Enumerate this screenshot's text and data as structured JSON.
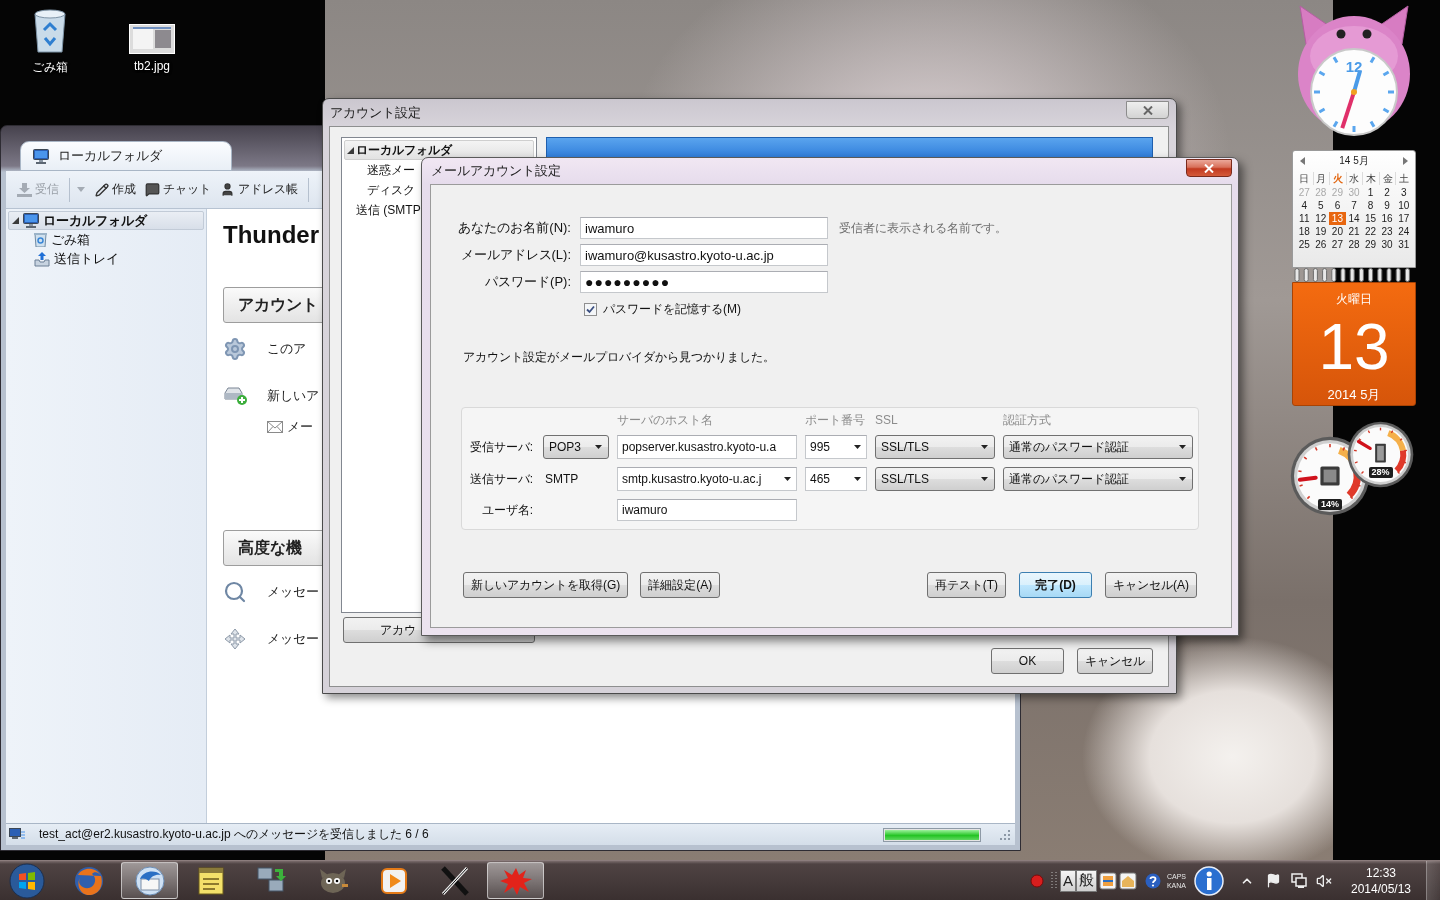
{
  "desktop_icons": [
    {
      "kind": "trash",
      "label": "ごみ箱"
    },
    {
      "kind": "image",
      "label": "tb2.jpg"
    }
  ],
  "mail_window": {
    "tab": {
      "label": "ローカルフォルダ",
      "selected": true
    },
    "toolbar": [
      {
        "kind": "get",
        "label": "受信",
        "disabled": true
      },
      {
        "kind": "write",
        "label": "作成",
        "disabled": false
      },
      {
        "kind": "chat",
        "label": "チャット",
        "disabled": false
      },
      {
        "kind": "address",
        "label": "アドレス帳",
        "disabled": false
      }
    ],
    "folders": [
      {
        "kind": "account",
        "label": "ローカルフォルダ",
        "selected": true,
        "expanded": true,
        "children": [
          {
            "kind": "trash",
            "label": "ごみ箱",
            "selected": false
          },
          {
            "kind": "outbox",
            "label": "送信トレイ",
            "selected": false
          }
        ]
      }
    ],
    "heading": "Thunder",
    "sections": [
      {
        "title": "アカウント",
        "items": [
          {
            "kind": "settings",
            "label": "このア"
          },
          {
            "kind": "new-account",
            "label": "新しいア"
          },
          {
            "kind": "mail",
            "label": "メー"
          }
        ]
      },
      {
        "title": "高度な機",
        "items": [
          {
            "kind": "search",
            "label": "メッセー"
          },
          {
            "kind": "filter",
            "label": "メッセー"
          }
        ]
      }
    ],
    "status_bar": {
      "text": "test_act@er2.kusastro.kyoto-u.ac.jp へのメッセージを受信しました 6 / 6",
      "level": 1
    }
  },
  "account_settings": {
    "title": "アカウント設定",
    "tree": [
      {
        "label": "ローカルフォルダ",
        "selected": true,
        "expanded": true,
        "children": [
          {
            "label": "迷惑メー",
            "selected": false
          },
          {
            "label": "ディスク",
            "selected": false
          }
        ]
      },
      {
        "label": "送信 (SMTP",
        "selected": false
      }
    ],
    "action_button": "アカウ",
    "buttons": [
      "OK",
      "キャンセル"
    ]
  },
  "mail_setup": {
    "title": "メールアカウント設定",
    "fields": [
      {
        "kind": "text",
        "label": "あなたのお名前(N):",
        "value": "iwamuro",
        "hint": "受信者に表示される名前です。"
      },
      {
        "kind": "text",
        "label": "メールアドレス(L):",
        "value": "iwamuro@kusastro.kyoto-u.ac.jp"
      },
      {
        "kind": "password",
        "label": "パスワード(P):",
        "value": "●●●●●●●●●"
      }
    ],
    "remember_password": {
      "label": "パスワードを記憶する(M)",
      "checked": true
    },
    "message": "アカウント設定がメールプロバイダから見つかりました。",
    "server_columns": [
      "サーバのホスト名",
      "ポート番号",
      "SSL",
      "認証方式"
    ],
    "servers": [
      {
        "kind": "incoming",
        "label": "受信サーバ:",
        "protocol": "POP3",
        "host": "popserver.kusastro.kyoto-u.a",
        "port": "995",
        "ssl": "SSL/TLS",
        "auth": "通常のパスワード認証"
      },
      {
        "kind": "outgoing",
        "label": "送信サーバ:",
        "protocol": "SMTP",
        "host": "smtp.kusastro.kyoto-u.ac.j",
        "port": "465",
        "ssl": "SSL/TLS",
        "auth": "通常のパスワード認証"
      }
    ],
    "username": {
      "label": "ユーザ名:",
      "value": "iwamuro"
    },
    "left_buttons": [
      {
        "label": "新しいアカウントを取得(G)",
        "default": false
      },
      {
        "label": "詳細設定(A)",
        "default": false
      }
    ],
    "right_buttons": [
      {
        "label": "再テスト(T)",
        "default": false
      },
      {
        "label": "完了(D)",
        "default": true
      },
      {
        "label": "キャンセル(A)",
        "default": false
      }
    ]
  },
  "clock_gadget": {
    "numeral": "12"
  },
  "calendar_gadget": {
    "header": "14 5月",
    "weekdays": [
      {
        "label": "日",
        "highlighted": false
      },
      {
        "label": "月",
        "highlighted": false
      },
      {
        "label": "火",
        "highlighted": true
      },
      {
        "label": "水",
        "highlighted": false
      },
      {
        "label": "木",
        "highlighted": false
      },
      {
        "label": "金",
        "highlighted": false
      },
      {
        "label": "土",
        "highlighted": false
      }
    ],
    "days": [
      {
        "label": "27",
        "outside": true,
        "selected": false
      },
      {
        "label": "28",
        "outside": true,
        "selected": false
      },
      {
        "label": "29",
        "outside": true,
        "selected": false
      },
      {
        "label": "30",
        "outside": true,
        "selected": false
      },
      {
        "label": "1",
        "outside": false,
        "selected": false
      },
      {
        "label": "2",
        "outside": false,
        "selected": false
      },
      {
        "label": "3",
        "outside": false,
        "selected": false
      },
      {
        "label": "4",
        "outside": false,
        "selected": false
      },
      {
        "label": "5",
        "outside": false,
        "selected": false
      },
      {
        "label": "6",
        "outside": false,
        "selected": false
      },
      {
        "label": "7",
        "outside": false,
        "selected": false
      },
      {
        "label": "8",
        "outside": false,
        "selected": false
      },
      {
        "label": "9",
        "outside": false,
        "selected": false
      },
      {
        "label": "10",
        "outside": false,
        "selected": false
      },
      {
        "label": "11",
        "outside": false,
        "selected": false
      },
      {
        "label": "12",
        "outside": false,
        "selected": false
      },
      {
        "label": "13",
        "outside": false,
        "selected": true
      },
      {
        "label": "14",
        "outside": false,
        "selected": false
      },
      {
        "label": "15",
        "outside": false,
        "selected": false
      },
      {
        "label": "16",
        "outside": false,
        "selected": false
      },
      {
        "label": "17",
        "outside": false,
        "selected": false
      },
      {
        "label": "18",
        "outside": false,
        "selected": false
      },
      {
        "label": "19",
        "outside": false,
        "selected": false
      },
      {
        "label": "20",
        "outside": false,
        "selected": false
      },
      {
        "label": "21",
        "outside": false,
        "selected": false
      },
      {
        "label": "22",
        "outside": false,
        "selected": false
      },
      {
        "label": "23",
        "outside": false,
        "selected": false
      },
      {
        "label": "24",
        "outside": false,
        "selected": false
      },
      {
        "label": "25",
        "outside": false,
        "selected": false
      },
      {
        "label": "26",
        "outside": false,
        "selected": false
      },
      {
        "label": "27",
        "outside": false,
        "selected": false
      },
      {
        "label": "28",
        "outside": false,
        "selected": false
      },
      {
        "label": "29",
        "outside": false,
        "selected": false
      },
      {
        "label": "30",
        "outside": false,
        "selected": false
      },
      {
        "label": "31",
        "outside": false,
        "selected": false
      }
    ],
    "weekday": "火曜日",
    "day": "13",
    "month": "2014 5月"
  },
  "meter_gadget": {
    "meters": [
      {
        "kind": "cpu",
        "level": 0.14,
        "reading": "14%"
      },
      {
        "kind": "memory",
        "level": 0.28,
        "reading": "28%"
      }
    ]
  },
  "taskbar": {
    "apps": [
      {
        "kind": "fox-globe",
        "selected": false
      },
      {
        "kind": "bird-mail",
        "selected": true
      },
      {
        "kind": "notepad",
        "selected": false
      },
      {
        "kind": "network",
        "selected": false
      },
      {
        "kind": "animal",
        "selected": false
      },
      {
        "kind": "player",
        "selected": false
      },
      {
        "kind": "cross",
        "selected": false
      },
      {
        "kind": "splat",
        "selected": true
      }
    ],
    "ime": {
      "input_mode": "A",
      "conversion_mode": "般"
    },
    "caps": "CAPS",
    "kana": "KANA",
    "time": "12:33",
    "date": "2014/05/13"
  }
}
